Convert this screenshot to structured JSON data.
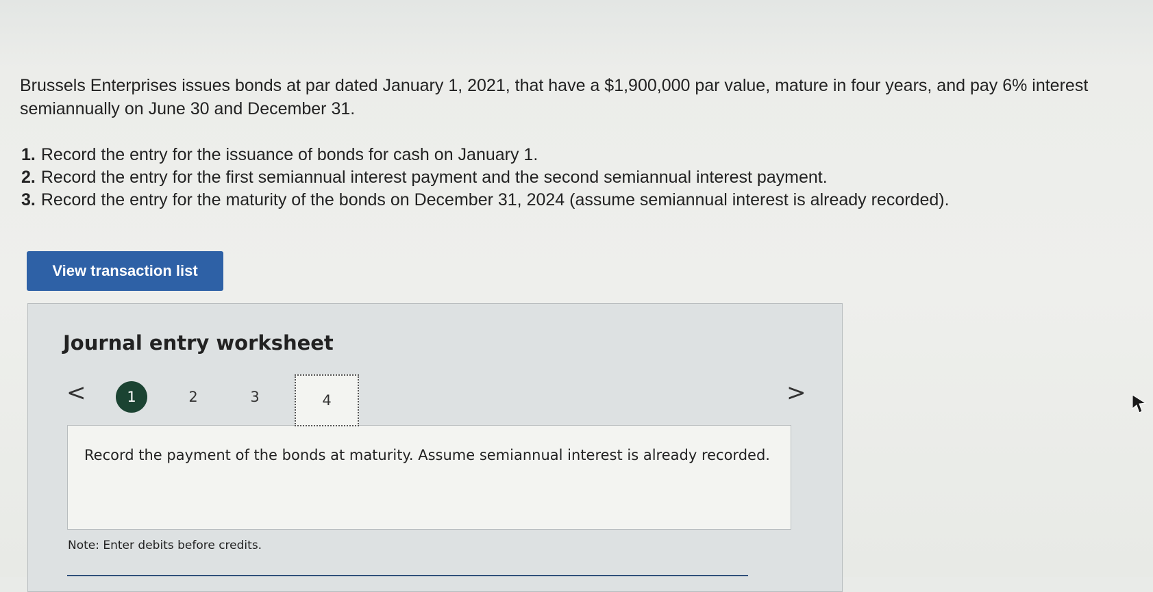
{
  "problem": {
    "text": "Brussels Enterprises issues bonds at par dated January 1, 2021, that have a $1,900,000 par value, mature in four years, and pay 6% interest semiannually on June 30 and December 31."
  },
  "requirements": [
    {
      "num": "1.",
      "text": "Record the entry for the issuance of bonds for cash on January 1."
    },
    {
      "num": "2.",
      "text": "Record the entry for the first semiannual interest payment and the second semiannual interest payment."
    },
    {
      "num": "3.",
      "text": "Record the entry for the maturity of the bonds on December 31, 2024 (assume semiannual interest is already recorded)."
    }
  ],
  "view_button_label": "View transaction list",
  "worksheet": {
    "title": "Journal entry worksheet",
    "prev_icon": "chevron-left-icon",
    "next_icon": "chevron-right-icon",
    "prev_glyph": "<",
    "next_glyph": ">",
    "steps": [
      "1",
      "2",
      "3",
      "4"
    ],
    "active_step": "1",
    "current_step": "4",
    "instruction": "Record the payment of the bonds at maturity. Assume semiannual interest is already recorded.",
    "note": "Note: Enter debits before credits."
  },
  "colors": {
    "button_bg": "#2e61a6",
    "active_step_bg": "#1b4332",
    "worksheet_bg": "#dde1e2"
  }
}
